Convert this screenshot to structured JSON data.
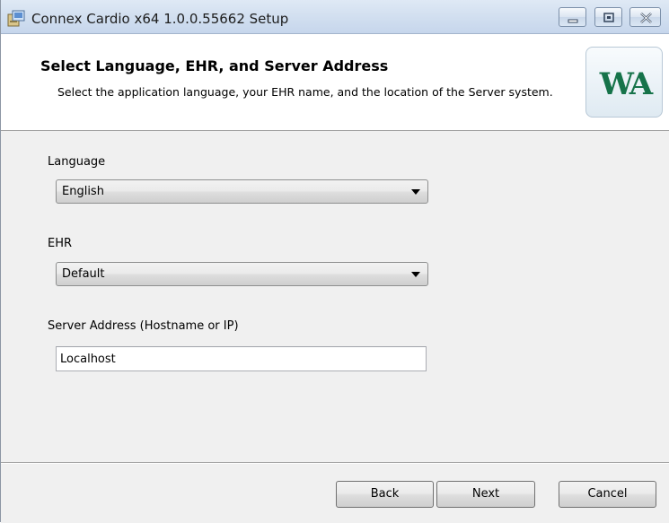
{
  "window": {
    "title": "Connex Cardio x64 1.0.0.55662 Setup",
    "icons": {
      "app": "installer-icon",
      "minimize": "minimize-icon",
      "maximize": "maximize-icon",
      "close": "close-icon"
    }
  },
  "banner": {
    "title": "Select Language, EHR, and Server Address",
    "description": "Select the application language, your EHR name, and the location of the Server system.",
    "logo_text": "WA",
    "logo_color": "#16734a"
  },
  "form": {
    "language": {
      "label": "Language",
      "value": "English"
    },
    "ehr": {
      "label": "EHR",
      "value": "Default"
    },
    "server": {
      "label": "Server Address (Hostname or IP)",
      "value": "Localhost"
    }
  },
  "footer": {
    "back_label": "Back",
    "next_label": "Next",
    "cancel_label": "Cancel"
  }
}
